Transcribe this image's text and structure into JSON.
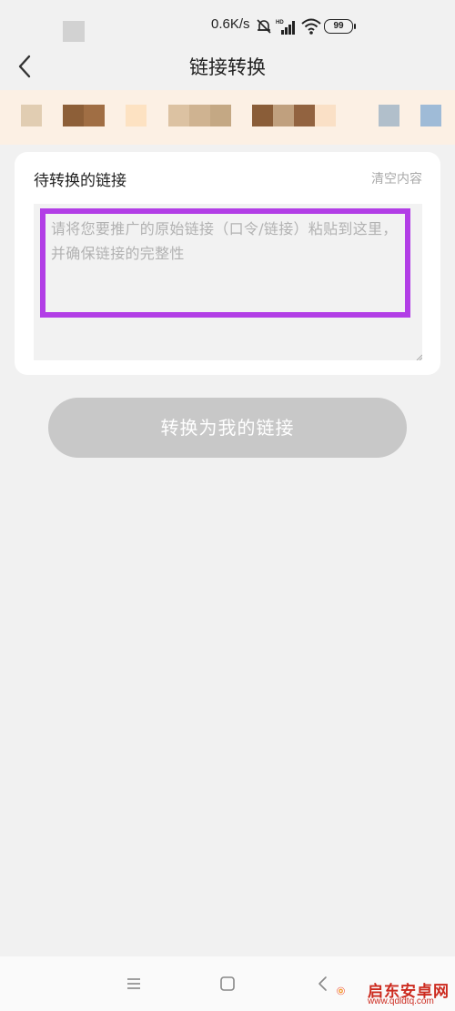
{
  "status_bar": {
    "speed": "0.6K/s",
    "battery": "99",
    "icons": [
      "mute-bell-icon",
      "hd-signal-icon",
      "wifi-icon",
      "battery-icon"
    ]
  },
  "nav": {
    "title": "链接转换",
    "back_icon": "chevron-left-icon"
  },
  "card": {
    "title": "待转换的链接",
    "clear_label": "清空内容",
    "input": {
      "placeholder": "请将您要推广的原始链接（口令/链接）粘贴到这里，并确保链接的完整性",
      "value": ""
    }
  },
  "convert_button": {
    "label": "转换为我的链接"
  },
  "colors": {
    "highlight": "#b23ee6",
    "banner_bg": "#fcf0e4",
    "button_disabled": "#c8c8c8",
    "page_bg": "#f1f1f1"
  },
  "system_nav": {
    "icons": [
      "menu-icon",
      "home-square-icon",
      "back-icon"
    ]
  },
  "watermark": {
    "name": "启东安卓网",
    "url": "www.qdldtq.com"
  }
}
